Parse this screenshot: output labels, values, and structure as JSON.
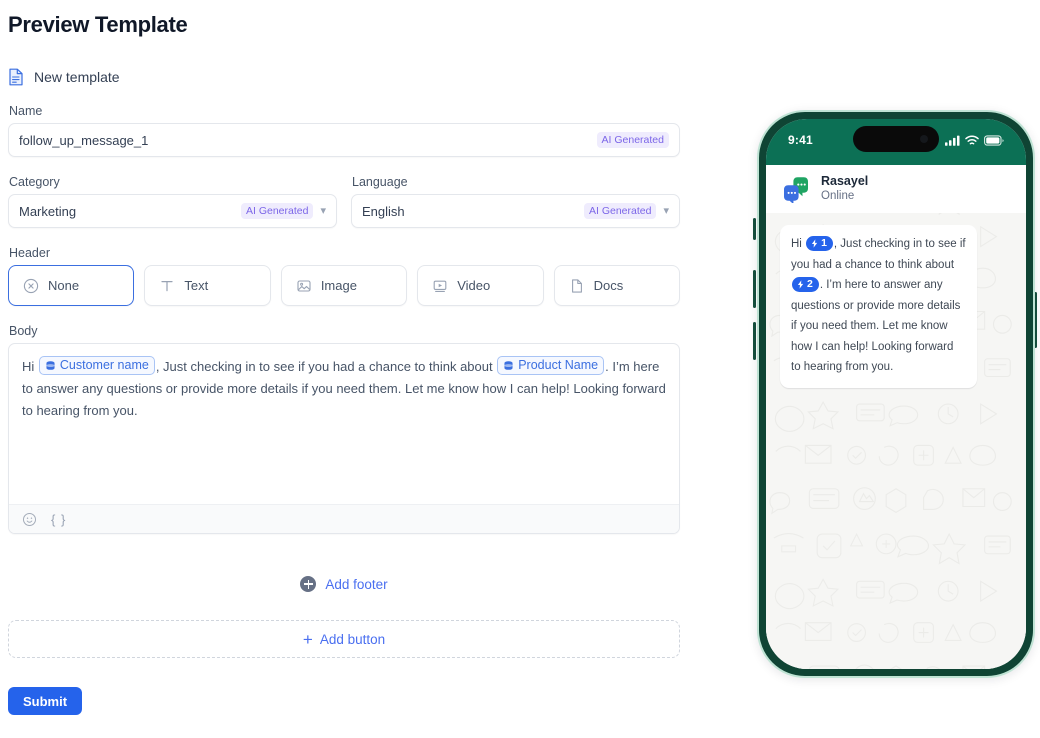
{
  "page": {
    "title": "Preview Template",
    "template_row_label": "New template"
  },
  "fields": {
    "name": {
      "label": "Name",
      "value": "follow_up_message_1",
      "badge": "AI Generated"
    },
    "category": {
      "label": "Category",
      "value": "Marketing",
      "badge": "AI Generated"
    },
    "language": {
      "label": "Language",
      "value": "English",
      "badge": "AI Generated"
    }
  },
  "header": {
    "label": "Header",
    "options": [
      {
        "label": "None",
        "icon": "circle-x-icon",
        "selected": true
      },
      {
        "label": "Text",
        "icon": "text-icon",
        "selected": false
      },
      {
        "label": "Image",
        "icon": "image-icon",
        "selected": false
      },
      {
        "label": "Video",
        "icon": "video-icon",
        "selected": false
      },
      {
        "label": "Docs",
        "icon": "document-icon",
        "selected": false
      }
    ]
  },
  "body": {
    "label": "Body",
    "segments": [
      {
        "type": "text",
        "text": "Hi "
      },
      {
        "type": "chip",
        "text": "Customer name"
      },
      {
        "type": "text",
        "text": ", Just checking in to see if you had a chance to think about "
      },
      {
        "type": "chip",
        "text": "Product Name"
      },
      {
        "type": "text",
        "text": ". I’m here to answer any questions or provide more details if you need them. Let me know how I can help! Looking forward to hearing from you."
      }
    ],
    "toolbar": {
      "emoji_icon": "emoji-icon",
      "variable_icon": "curly-braces-icon"
    }
  },
  "actions": {
    "add_footer": "Add footer",
    "add_button": "Add button",
    "submit": "Submit"
  },
  "preview": {
    "status_bar": {
      "time": "9:41",
      "signal_icon": "signal-icon",
      "wifi_icon": "wifi-icon",
      "battery_icon": "battery-icon"
    },
    "contact": {
      "name": "Rasayel",
      "status": "Online",
      "avatar_icon": "rasayel-logo-icon"
    },
    "message": {
      "segments": [
        {
          "type": "text",
          "text": "Hi "
        },
        {
          "type": "token",
          "text": "1"
        },
        {
          "type": "text",
          "text": ", Just checking in to see if you had a chance to think about "
        },
        {
          "type": "token",
          "text": "2"
        },
        {
          "type": "text",
          "text": ". I’m here to answer any questions or provide more details if you need them. Let me know how I can help! Looking forward to hearing from you."
        }
      ]
    }
  },
  "colors": {
    "accent_blue": "#2563eb",
    "link_blue": "#4a6ff0",
    "ai_badge_bg": "#efecfd",
    "ai_badge_text": "#7c66e8",
    "phone_frame": "#0f4434",
    "status_bar_green": "#0c7055"
  }
}
